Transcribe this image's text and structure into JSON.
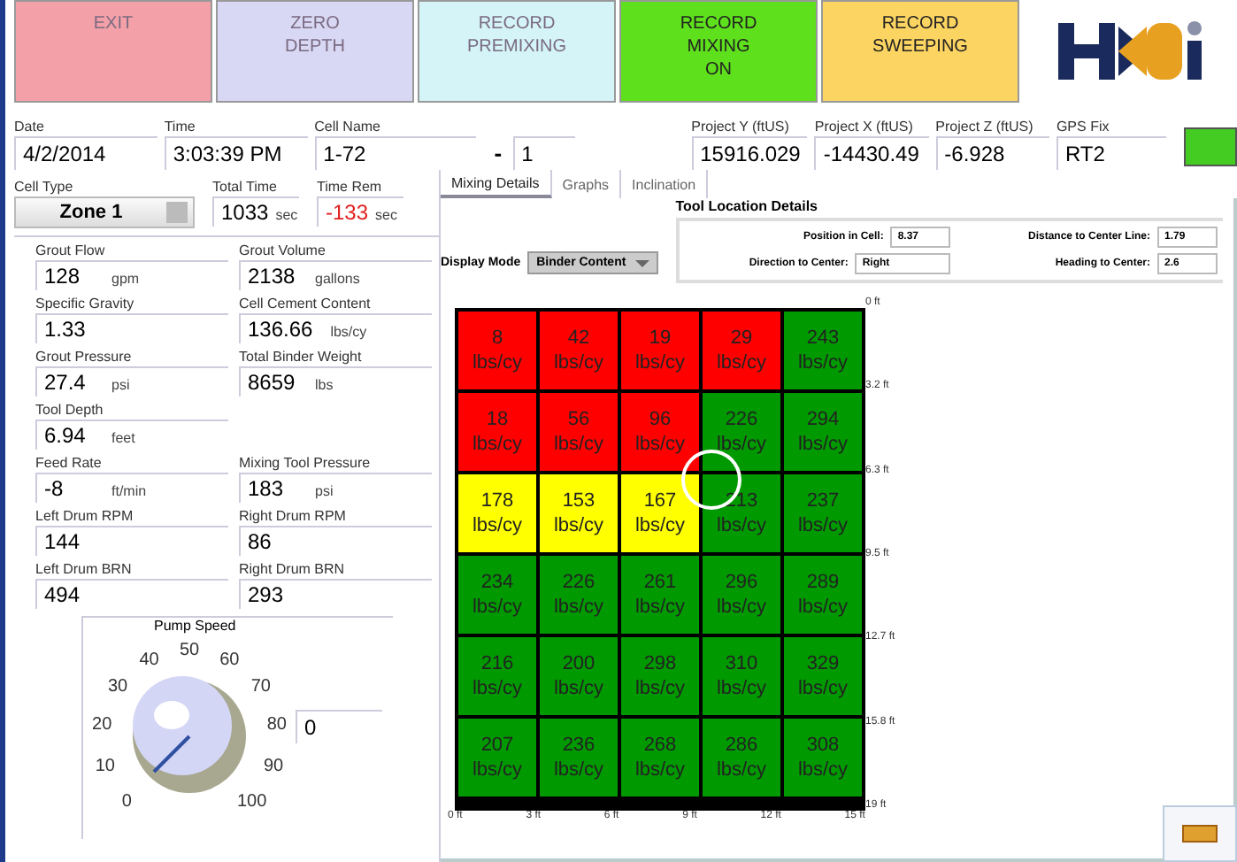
{
  "buttons": [
    {
      "label": "EXIT",
      "color": "#f4a0a8",
      "disabled": true
    },
    {
      "label": "ZERO\nDEPTH",
      "color": "#d8d8f4",
      "disabled": true
    },
    {
      "label": "RECORD\nPREMIXING",
      "color": "#d4f4f8",
      "disabled": true
    },
    {
      "label": "RECORD\nMIXING\nON",
      "color": "#5ee01c",
      "disabled": false
    },
    {
      "label": "RECORD\nSWEEPING",
      "color": "#fcd462",
      "disabled": false
    }
  ],
  "info": [
    {
      "label": "Date",
      "value": "4/2/2014"
    },
    {
      "label": "Time",
      "value": "3:03:39 PM"
    },
    {
      "label": "Cell Name",
      "value": "1-72",
      "sep": "-",
      "value2": "1"
    },
    {
      "label": "Project Y (ftUS)",
      "value": "15916.029"
    },
    {
      "label": "Project X (ftUS)",
      "value": "-14430.49"
    },
    {
      "label": "Project Z (ftUS)",
      "value": "-6.928"
    },
    {
      "label": "GPS Fix",
      "value": "RT2"
    }
  ],
  "gps_light": {
    "on": true
  },
  "cell_type": {
    "label": "Cell Type",
    "value": "Zone 1"
  },
  "times": [
    {
      "label": "Total Time",
      "value": "1033",
      "unit": "sec",
      "warning": false
    },
    {
      "label": "Time Rem",
      "value": "-133",
      "unit": "sec",
      "warning": true
    }
  ],
  "fields": [
    {
      "label": "Grout Flow",
      "value": "128",
      "unit": "gpm"
    },
    {
      "label": "Grout Volume",
      "value": "2138",
      "unit": "gallons"
    },
    {
      "label": "Specific Gravity",
      "value": "1.33"
    },
    {
      "label": "Cell Cement Content",
      "value": "136.66",
      "unit": "lbs/cy"
    },
    {
      "label": "Grout Pressure",
      "value": "27.4",
      "unit": "psi"
    },
    {
      "label": "Total Binder Weight",
      "value": "8659",
      "unit": "lbs"
    },
    {
      "label": "Tool Depth",
      "value": "6.94",
      "unit": "feet"
    },
    {
      "kind": "blank"
    },
    {
      "label": "Feed Rate",
      "value": "-8",
      "unit": "ft/min"
    },
    {
      "label": "Mixing Tool Pressure",
      "value": "183",
      "unit": "psi"
    },
    {
      "label": "Left Drum RPM",
      "value": "144"
    },
    {
      "label": "Right Drum RPM",
      "value": "86"
    },
    {
      "label": "Left Drum BRN",
      "value": "494"
    },
    {
      "label": "Right Drum BRN",
      "value": "293"
    }
  ],
  "pump_speed": {
    "label": "Pump Speed",
    "ticks": [
      "0",
      "10",
      "20",
      "30",
      "40",
      "50",
      "60",
      "70",
      "80",
      "90",
      "100"
    ],
    "value": "0"
  },
  "tabs": [
    {
      "label": "Mixing Details",
      "selected": true
    },
    {
      "label": "Graphs",
      "selected": false
    },
    {
      "label": "Inclination",
      "selected": false
    }
  ],
  "display_mode": {
    "label": "Display Mode",
    "value": "Binder Content"
  },
  "tool_location": {
    "title": "Tool Location Details",
    "fields": [
      {
        "label": "Position in Cell:",
        "value": "8.37"
      },
      {
        "label": "Distance to Center Line:",
        "value": "1.79"
      },
      {
        "label": "Direction to Center:",
        "value": "Right"
      },
      {
        "label": "Heading to Center:",
        "value": "2.6"
      }
    ]
  },
  "grid": {
    "rows": [
      [
        {
          "value": "8",
          "unit": "lbs/cy",
          "color": "#ff0000"
        },
        {
          "value": "42",
          "unit": "lbs/cy",
          "color": "#ff0000"
        },
        {
          "value": "19",
          "unit": "lbs/cy",
          "color": "#ff0000"
        },
        {
          "value": "29",
          "unit": "lbs/cy",
          "color": "#ff0000"
        },
        {
          "value": "243",
          "unit": "lbs/cy",
          "color": "#009900"
        }
      ],
      [
        {
          "value": "18",
          "unit": "lbs/cy",
          "color": "#ff0000"
        },
        {
          "value": "56",
          "unit": "lbs/cy",
          "color": "#ff0000"
        },
        {
          "value": "96",
          "unit": "lbs/cy",
          "color": "#ff0000"
        },
        {
          "value": "226",
          "unit": "lbs/cy",
          "color": "#009900"
        },
        {
          "value": "294",
          "unit": "lbs/cy",
          "color": "#009900"
        }
      ],
      [
        {
          "value": "178",
          "unit": "lbs/cy",
          "color": "#ffff00"
        },
        {
          "value": "153",
          "unit": "lbs/cy",
          "color": "#ffff00"
        },
        {
          "value": "167",
          "unit": "lbs/cy",
          "color": "#ffff00"
        },
        {
          "value": "213",
          "unit": "lbs/cy",
          "color": "#009900"
        },
        {
          "value": "237",
          "unit": "lbs/cy",
          "color": "#009900"
        }
      ],
      [
        {
          "value": "234",
          "unit": "lbs/cy",
          "color": "#009900"
        },
        {
          "value": "226",
          "unit": "lbs/cy",
          "color": "#009900"
        },
        {
          "value": "261",
          "unit": "lbs/cy",
          "color": "#009900"
        },
        {
          "value": "296",
          "unit": "lbs/cy",
          "color": "#009900"
        },
        {
          "value": "289",
          "unit": "lbs/cy",
          "color": "#009900"
        }
      ],
      [
        {
          "value": "216",
          "unit": "lbs/cy",
          "color": "#009900"
        },
        {
          "value": "200",
          "unit": "lbs/cy",
          "color": "#009900"
        },
        {
          "value": "298",
          "unit": "lbs/cy",
          "color": "#009900"
        },
        {
          "value": "310",
          "unit": "lbs/cy",
          "color": "#009900"
        },
        {
          "value": "329",
          "unit": "lbs/cy",
          "color": "#009900"
        }
      ],
      [
        {
          "value": "207",
          "unit": "lbs/cy",
          "color": "#009900"
        },
        {
          "value": "236",
          "unit": "lbs/cy",
          "color": "#009900"
        },
        {
          "value": "268",
          "unit": "lbs/cy",
          "color": "#009900"
        },
        {
          "value": "286",
          "unit": "lbs/cy",
          "color": "#009900"
        },
        {
          "value": "308",
          "unit": "lbs/cy",
          "color": "#009900"
        }
      ]
    ],
    "y_labels": [
      "0 ft",
      "3.2 ft",
      "6.3 ft",
      "9.5 ft",
      "12.7 ft",
      "15.8 ft",
      "19 ft"
    ],
    "x_labels": [
      "0 ft",
      "3 ft",
      "6 ft",
      "9 ft",
      "12 ft",
      "15 ft"
    ]
  }
}
